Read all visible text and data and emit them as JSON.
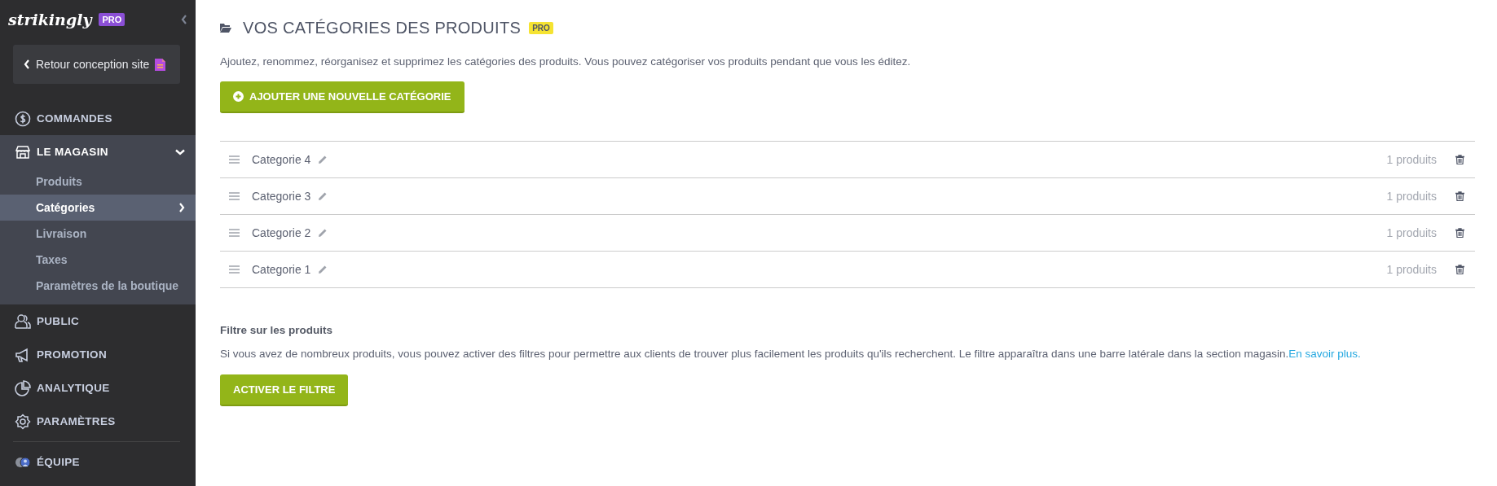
{
  "sidebar": {
    "logo": "strikingly",
    "logo_badge": "PRO",
    "back_button": "Retour conception site",
    "nav": [
      {
        "label": "COMMANDES",
        "expanded": false
      },
      {
        "label": "LE MAGASIN",
        "expanded": true,
        "children": [
          {
            "label": "Produits",
            "selected": false
          },
          {
            "label": "Catégories",
            "selected": true
          },
          {
            "label": "Livraison",
            "selected": false
          },
          {
            "label": "Taxes",
            "selected": false
          },
          {
            "label": "Paramètres de la boutique",
            "selected": false
          }
        ]
      },
      {
        "label": "PUBLIC",
        "expanded": false
      },
      {
        "label": "PROMOTION",
        "expanded": false
      },
      {
        "label": "ANALYTIQUE",
        "expanded": false
      },
      {
        "label": "PARAMÈTRES",
        "expanded": false
      },
      {
        "label": "ÉQUIPE",
        "expanded": false
      }
    ]
  },
  "page": {
    "title": "VOS CATÉGORIES DES PRODUITS",
    "title_badge": "PRO",
    "description": "Ajoutez, renommez, réorganisez et supprimez les catégories des produits. Vous pouvez catégoriser vos produits pendant que vous les éditez.",
    "add_button": "AJOUTER UNE NOUVELLE CATÉGORIE",
    "categories": [
      {
        "name": "Categorie 4",
        "count": "1 produits"
      },
      {
        "name": "Categorie 3",
        "count": "1 produits"
      },
      {
        "name": "Categorie 2",
        "count": "1 produits"
      },
      {
        "name": "Categorie 1",
        "count": "1 produits"
      }
    ],
    "filter": {
      "title": "Filtre sur les produits",
      "text": "Si vous avez de nombreux produits, vous pouvez activer des filtres pour permettre aux clients de trouver plus facilement les produits qu'ils recherchent. Le filtre apparaîtra dans une barre latérale dans la section magasin.",
      "link": "En savoir plus.",
      "button": "ACTIVER LE FILTRE"
    }
  }
}
